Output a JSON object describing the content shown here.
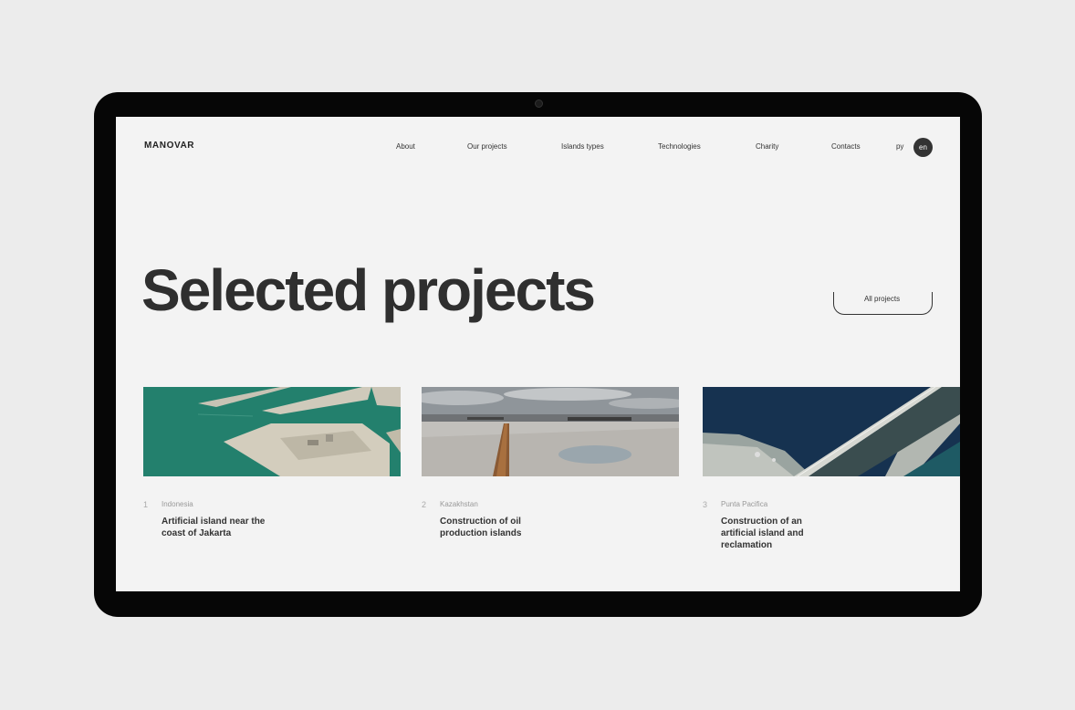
{
  "header": {
    "logo": "MANOVAR",
    "nav": [
      "About",
      "Our projects",
      "Islands types",
      "Technologies",
      "Charity",
      "Contacts"
    ],
    "lang_ru": "ру",
    "lang_en": "en"
  },
  "hero": {
    "title": "Selected projects",
    "all_projects_label": "All projects"
  },
  "projects": [
    {
      "number": "1",
      "location": "Indonesia",
      "title": "Artificial island near the coast of Jakarta"
    },
    {
      "number": "2",
      "location": "Kazakhstan",
      "title": "Construction of oil production islands"
    },
    {
      "number": "3",
      "location": "Punta Pacifica",
      "title": "Construction of an artificial island and reclamation"
    }
  ],
  "colors": {
    "accent": "#333333",
    "background": "#f3f3f3",
    "frame": "#060606"
  }
}
